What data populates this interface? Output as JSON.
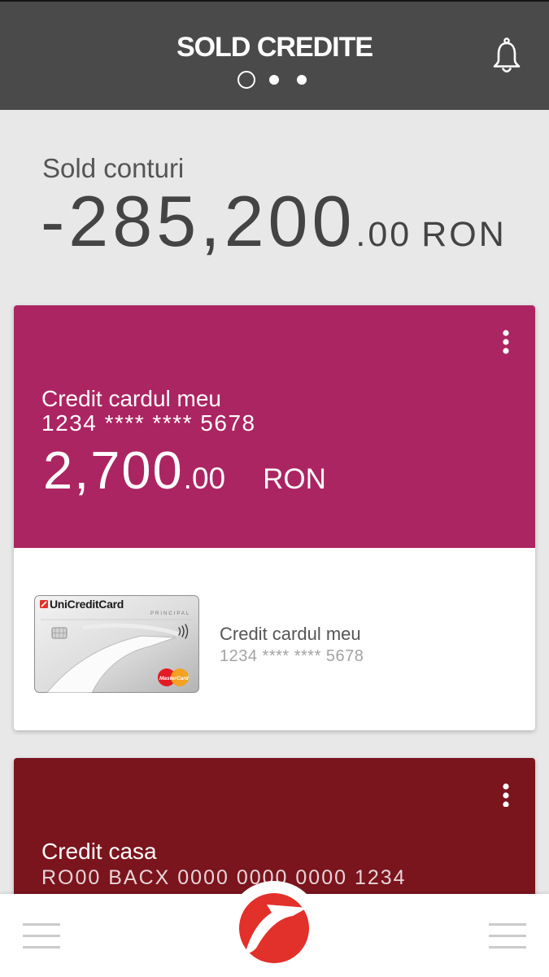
{
  "header": {
    "title": "SOLD CREDITE",
    "page_indicator": {
      "count": 3,
      "active_index": 0
    },
    "notification_icon": "bell-icon"
  },
  "summary": {
    "label": "Sold conturi",
    "amount_integer": "-285,200",
    "amount_decimals": ".00",
    "currency": "RON"
  },
  "accounts": [
    {
      "name": "Credit cardul meu",
      "number": "1234 **** **** 5678",
      "amount_integer": "2,700",
      "amount_decimals": ".00",
      "currency": "RON",
      "color": "#ab2562",
      "menu_icon": "kebab-menu-icon",
      "card": {
        "name": "Credit cardul meu",
        "number": "1234 **** **** 5678",
        "image": {
          "brand": "UniCreditCard",
          "tier": "PRINCIPAL",
          "network": "MasterCard"
        }
      }
    },
    {
      "name": "Credit casa",
      "number": "RO00 BACX 0000 0000 0000 1234",
      "color": "#7a141d",
      "menu_icon": "kebab-menu-icon"
    }
  ],
  "bottom_nav": {
    "left_icon": "hamburger-menu-icon",
    "center_icon": "unicredit-logo",
    "right_icon": "hamburger-menu-icon"
  },
  "colors": {
    "header_bg": "#4a4a4a",
    "page_bg": "#e8e8e8",
    "brand_red": "#e2302a"
  }
}
